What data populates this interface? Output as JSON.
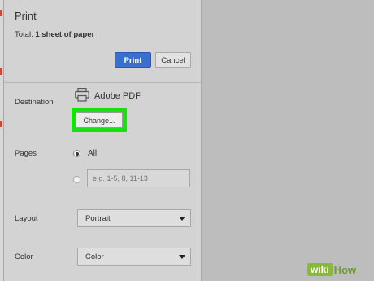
{
  "dialog": {
    "title": "Print",
    "total_label": "Total:",
    "total_value": "1 sheet of paper",
    "print_button": "Print",
    "cancel_button": "Cancel"
  },
  "destination": {
    "label": "Destination",
    "printer_name": "Adobe PDF",
    "printer_icon": "printer-icon",
    "change_button": "Change...",
    "highlight_color": "#19e011"
  },
  "pages": {
    "label": "Pages",
    "all_label": "All",
    "all_selected": true,
    "custom_placeholder": "e.g. 1-5, 8, 11-13"
  },
  "layout": {
    "label": "Layout",
    "value": "Portrait"
  },
  "color": {
    "label": "Color",
    "value": "Color"
  },
  "colors": {
    "print_button": "#3a6fcf"
  },
  "watermark": {
    "wiki": "wiki",
    "how": "How"
  }
}
